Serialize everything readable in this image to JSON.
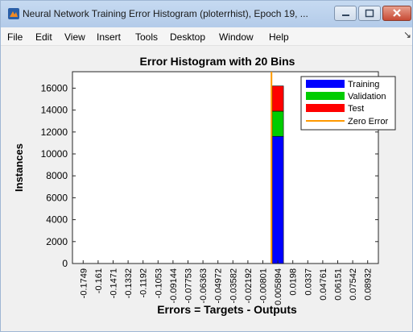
{
  "window": {
    "title": "Neural Network Training Error Histogram (ploterrhist), Epoch 19, ...",
    "controls": [
      "minimize",
      "maximize",
      "close"
    ]
  },
  "menu": [
    "File",
    "Edit",
    "View",
    "Insert",
    "Tools",
    "Desktop",
    "Window",
    "Help"
  ],
  "colors": {
    "training": "#0000ff",
    "validation": "#00cc00",
    "test": "#ff0000",
    "zero_error": "#ff9900"
  },
  "chart_data": {
    "type": "bar",
    "title": "Error Histogram with 20 Bins",
    "xlabel": "Errors = Targets - Outputs",
    "ylabel": "Instances",
    "ylim": [
      0,
      17500
    ],
    "yticks": [
      0,
      2000,
      4000,
      6000,
      8000,
      10000,
      12000,
      14000,
      16000
    ],
    "stacked": true,
    "categories": [
      "-0.1749",
      "-0.161",
      "-0.1471",
      "-0.1332",
      "-0.1192",
      "-0.1053",
      "-0.09144",
      "-0.07753",
      "-0.06363",
      "-0.04972",
      "-0.03582",
      "-0.02192",
      "-0.00801",
      "0.005894",
      "0.0198",
      "0.0337",
      "0.04761",
      "0.06151",
      "0.07542",
      "0.08932"
    ],
    "series": [
      {
        "name": "Training",
        "values": [
          0,
          0,
          0,
          0,
          0,
          0,
          0,
          0,
          0,
          0,
          0,
          0,
          0,
          11600,
          0,
          0,
          0,
          0,
          0,
          0
        ]
      },
      {
        "name": "Validation",
        "values": [
          0,
          0,
          0,
          0,
          0,
          0,
          0,
          0,
          0,
          0,
          0,
          0,
          0,
          2300,
          0,
          0,
          0,
          0,
          0,
          0
        ]
      },
      {
        "name": "Test",
        "values": [
          0,
          0,
          0,
          0,
          0,
          0,
          0,
          0,
          0,
          0,
          0,
          0,
          0,
          2300,
          0,
          0,
          0,
          0,
          0,
          0
        ]
      }
    ],
    "reference_line": {
      "name": "Zero Error",
      "x": 0
    },
    "legend_position": "top-right",
    "grid": false
  }
}
